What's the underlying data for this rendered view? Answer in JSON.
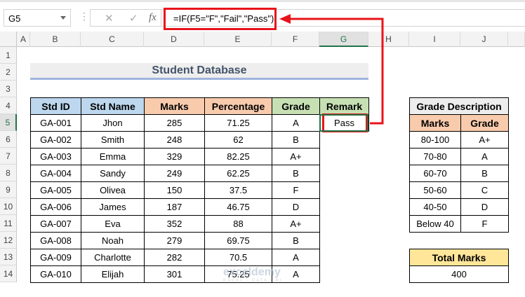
{
  "formula_bar": {
    "name_box": "G5",
    "cancel_icon": "✕",
    "enter_icon": "✓",
    "fx_label": "fx",
    "formula": "=IF(F5=\"F\",\"Fail\",\"Pass\")"
  },
  "columns": [
    "A",
    "B",
    "C",
    "D",
    "E",
    "F",
    "G",
    "H",
    "I",
    "J"
  ],
  "rows": [
    "1",
    "2",
    "3",
    "4",
    "5",
    "6",
    "7",
    "8",
    "9",
    "10",
    "11",
    "12",
    "13",
    "14"
  ],
  "title": "Student Database",
  "student_table": {
    "headers": [
      "Std ID",
      "Std Name",
      "Marks",
      "Percentage",
      "Grade",
      "Remark"
    ],
    "rows": [
      [
        "GA-001",
        "Jhon",
        "285",
        "71.25",
        "A",
        "Pass"
      ],
      [
        "GA-002",
        "Smith",
        "248",
        "62",
        "B",
        ""
      ],
      [
        "GA-003",
        "Emma",
        "329",
        "82.25",
        "A+",
        ""
      ],
      [
        "GA-004",
        "Sandy",
        "249",
        "62.25",
        "B",
        ""
      ],
      [
        "GA-005",
        "Olivea",
        "150",
        "37.5",
        "F",
        ""
      ],
      [
        "GA-006",
        "James",
        "187",
        "46.75",
        "D",
        ""
      ],
      [
        "GA-007",
        "Eva",
        "352",
        "88",
        "A+",
        ""
      ],
      [
        "GA-008",
        "Noah",
        "279",
        "69.75",
        "B",
        ""
      ],
      [
        "GA-009",
        "Charlotte",
        "282",
        "70.5",
        "A",
        ""
      ],
      [
        "GA-010",
        "Elijah",
        "301",
        "75.25",
        "A",
        ""
      ]
    ]
  },
  "grade_table": {
    "title": "Grade Description",
    "headers": [
      "Marks",
      "Grade"
    ],
    "rows": [
      [
        "80-100",
        "A+"
      ],
      [
        "70-80",
        "A"
      ],
      [
        "60-70",
        "B"
      ],
      [
        "50-60",
        "C"
      ],
      [
        "40-50",
        "D"
      ],
      [
        "Below 40",
        "F"
      ]
    ]
  },
  "total_marks": {
    "label": "Total Marks",
    "value": "400"
  },
  "watermark": {
    "name": "exceldemy",
    "tagline": "EXCEL · DATA · BI"
  },
  "colors": {
    "id_header": "#bdd7ee",
    "marks_header": "#f8cbad",
    "grade_header": "#c6e0b4",
    "desc_header": "#ededed",
    "total_header": "#ffe699",
    "highlight": "#e8141b"
  }
}
